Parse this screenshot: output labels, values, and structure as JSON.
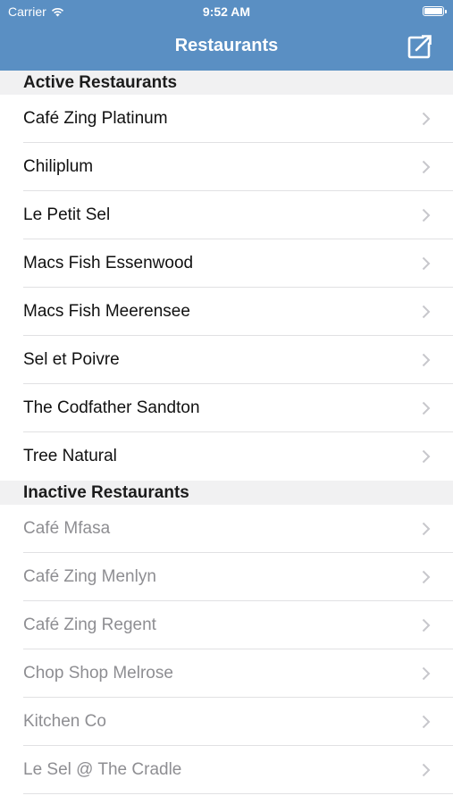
{
  "status_bar": {
    "carrier": "Carrier",
    "time": "9:52 AM"
  },
  "nav": {
    "title": "Restaurants",
    "action_icon": "compose-external-icon"
  },
  "colors": {
    "nav_bg": "#5a8fc3",
    "section_bg": "#f1f1f2",
    "inactive_text": "#8e8e92",
    "chevron": "#c7c7cc"
  },
  "sections": [
    {
      "title": "Active Restaurants",
      "items": [
        "Café Zing Platinum",
        "Chiliplum",
        "Le Petit Sel",
        "Macs Fish Essenwood",
        "Macs Fish Meerensee",
        "Sel et Poivre",
        "The Codfather Sandton",
        "Tree Natural"
      ]
    },
    {
      "title": "Inactive Restaurants",
      "items": [
        "Café Mfasa",
        "Café Zing Menlyn",
        "Café Zing Regent",
        "Chop Shop Melrose",
        "Kitchen Co",
        "Le Sel @ The Cradle"
      ]
    }
  ]
}
